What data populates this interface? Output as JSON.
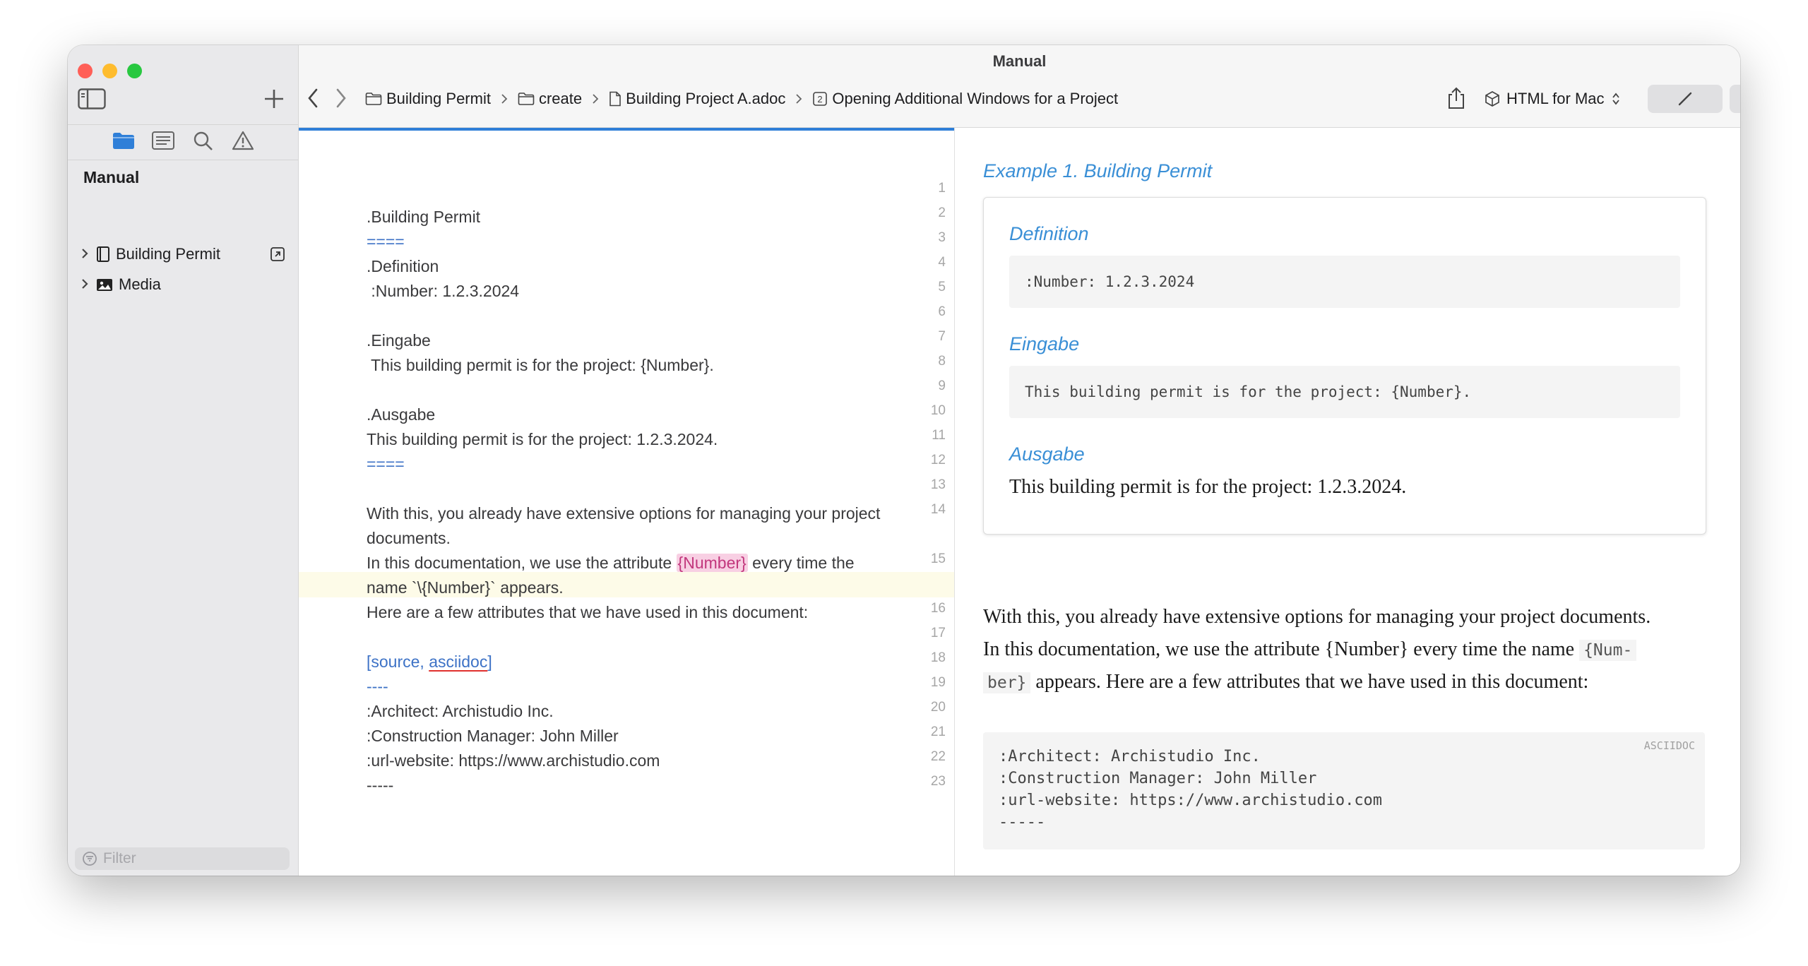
{
  "window": {
    "title": "Manual"
  },
  "sidebar": {
    "section_title": "Manual",
    "items": [
      {
        "label": "Building Permit"
      },
      {
        "label": "Media"
      }
    ],
    "filter_placeholder": "Filter"
  },
  "breadcrumb": [
    {
      "label": "Building Permit"
    },
    {
      "label": "create"
    },
    {
      "label": "Building Project A.adoc"
    },
    {
      "label": "Opening Additional Windows for a Project"
    }
  ],
  "toolbar": {
    "format_label": "HTML for Mac"
  },
  "editor": {
    "line_numbers": [
      "1",
      "2",
      "3",
      "4",
      "5",
      "6",
      "7",
      "8",
      "9",
      "10",
      "11",
      "12",
      "13",
      "14",
      "15",
      "16",
      "17",
      "18",
      "19",
      "20",
      "21",
      "22",
      "23"
    ],
    "lines": {
      "l2": ".Building Permit",
      "l3": "====",
      "l4": ".Definition",
      "l5": " :Number: 1.2.3.2024",
      "l7": ".Eingabe",
      "l8": " This building permit is for the project: {Number}.",
      "l10": ".Ausgabe",
      "l11": "This building permit is for the project: 1.2.3.2024.",
      "l12": "====",
      "l14a": "With this, you already have extensive options for managing your project",
      "l14b": "documents.",
      "l15a_pre": "In this documentation, we use the attribute ",
      "l15a_attr": "{Number}",
      "l15a_post": " every time the",
      "l15b": "name `\\{Number}` appears.",
      "l16": "Here are a few attributes that we have used in this document:",
      "l18_pre": "[source, ",
      "l18_word": "asciidoc",
      "l18_post": "]",
      "l19": "----",
      "l20": ":Architect: Archistudio Inc.",
      "l21": ":Construction Manager: John Miller",
      "l22": ":url-website: https://www.archistudio.com",
      "l23": "-----"
    }
  },
  "preview": {
    "example_title": "Example 1. Building Permit",
    "definition_title": "Definition",
    "definition_code": ":Number: 1.2.3.2024",
    "eingabe_title": "Eingabe",
    "eingabe_code": "This building permit is for the project: {Number}.",
    "ausgabe_title": "Ausgabe",
    "ausgabe_text": "This building permit is for the project: 1.2.3.2024.",
    "para_line1": "With this, you already have extensive options for managing your project documents.",
    "para_line2_pre": "In this documentation, we use the attribute {Number} every time the name ",
    "para_code_a": "{Num-",
    "para_code_b": "ber}",
    "para_line3_post": " appears. Here are a few attributes that we have used in this document:",
    "listing_lang": "ASCIIDOC",
    "listing_lines": [
      ":Architect: Archistudio Inc.",
      ":Construction Manager: John Miller",
      ":url-website: https://www.archistudio.com",
      "-----"
    ]
  },
  "colors": {
    "accent": "#2f7fd8",
    "preview_title": "#3a8fd6",
    "attribute_highlight": "#f8cfe3",
    "delimiter_blue": "#3d72c6"
  }
}
